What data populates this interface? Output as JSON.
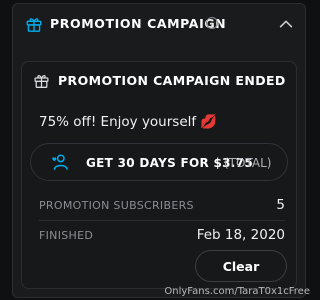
{
  "header": {
    "title": "PROMOTION CAMPAIGN",
    "gift_icon": "gift-icon",
    "info_icon": "info-icon",
    "info_glyph": "i",
    "collapse_icon": "chevron-up-icon"
  },
  "card": {
    "title": "PROMOTION CAMPAIGN ENDED",
    "gift_icon": "gift-icon",
    "discount_text": "75% off! Enjoy yourself 💋",
    "offer_button": {
      "icon": "user-heart-icon",
      "label_strong": "GET 30 DAYS FOR $3.75",
      "label_light": "(TOTAL)"
    },
    "rows": [
      {
        "label": "PROMOTION SUBSCRIBERS",
        "value": "5"
      },
      {
        "label": "FINISHED",
        "value": "Feb 18, 2020"
      }
    ],
    "clear_label": "Clear"
  },
  "watermark": "OnlyFans.com/TaraT0x1cFree",
  "colors": {
    "background": "#0f1012",
    "panel": "#1a1b1d",
    "accent": "#00aff0",
    "text": "#ffffff"
  }
}
